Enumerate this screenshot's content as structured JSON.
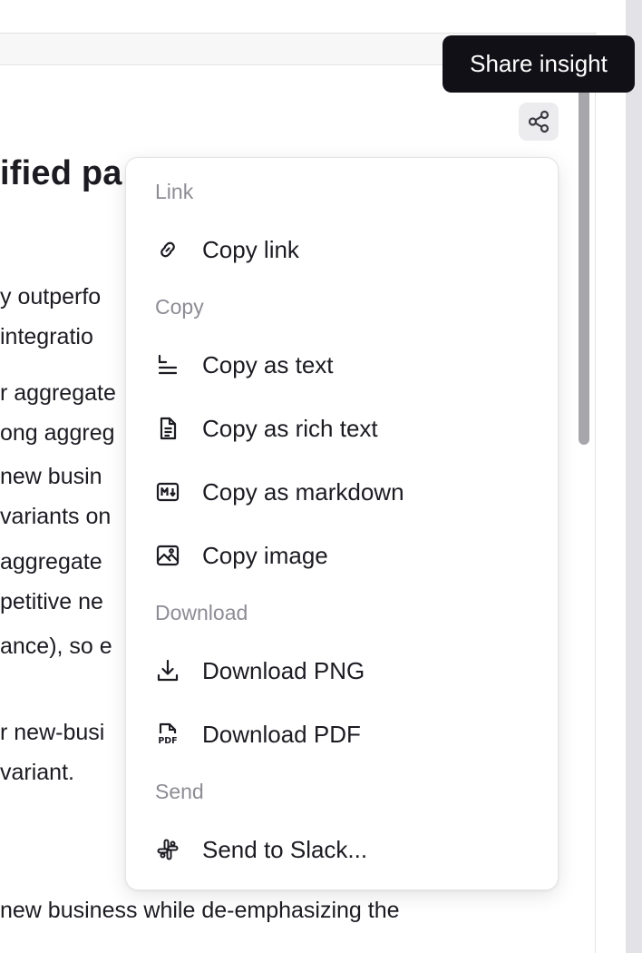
{
  "tooltip": {
    "text": "Share insight"
  },
  "share_button": {
    "icon": "share-icon"
  },
  "document": {
    "title_fragment": "ified pa",
    "lines": [
      "y outperfo",
      " integratio",
      "r aggregate",
      "ong aggreg",
      "new busin",
      "variants on",
      " aggregate",
      "petitive ne",
      "ance), so e",
      "r new-busi",
      "variant.",
      "new business while de-emphasizing the"
    ]
  },
  "menu": {
    "groups": [
      {
        "label": "Link",
        "items": [
          {
            "label": "Copy link",
            "icon": "link-icon"
          }
        ]
      },
      {
        "label": "Copy",
        "items": [
          {
            "label": "Copy as text",
            "icon": "text-lines-icon"
          },
          {
            "label": "Copy as rich text",
            "icon": "document-icon"
          },
          {
            "label": "Copy as markdown",
            "icon": "markdown-icon"
          },
          {
            "label": "Copy image",
            "icon": "image-icon"
          }
        ]
      },
      {
        "label": "Download",
        "items": [
          {
            "label": "Download PNG",
            "icon": "download-icon"
          },
          {
            "label": "Download PDF",
            "icon": "pdf-file-icon"
          }
        ]
      },
      {
        "label": "Send",
        "items": [
          {
            "label": "Send to Slack...",
            "icon": "slack-icon"
          }
        ]
      }
    ]
  }
}
